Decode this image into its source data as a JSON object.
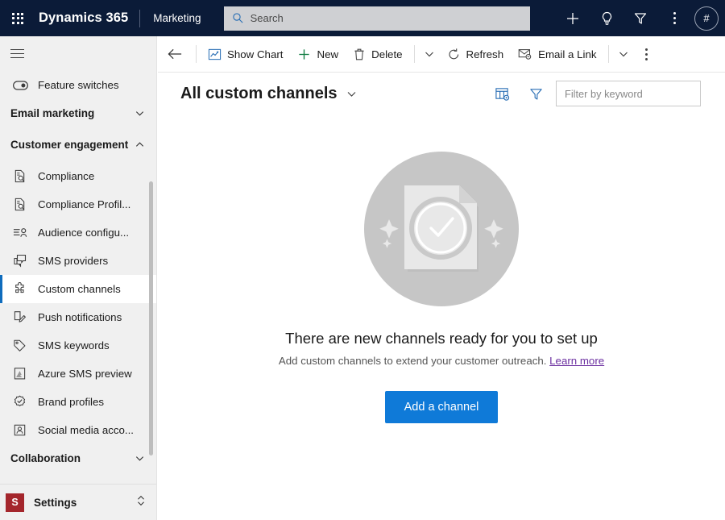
{
  "appbar": {
    "waffle_icon": "waffle-grid-icon",
    "brand": "Dynamics 365",
    "app_name": "Marketing",
    "search": {
      "placeholder": "Search",
      "value": "",
      "icon": "search-icon"
    },
    "actions": [
      {
        "name": "new-record-button",
        "icon": "plus-icon"
      },
      {
        "name": "ideas-button",
        "icon": "lightbulb-icon"
      },
      {
        "name": "filter-button",
        "icon": "funnel-icon"
      },
      {
        "name": "more-options-button",
        "icon": "ellipsis-vertical-icon"
      }
    ],
    "avatar_label": "#"
  },
  "sidebar": {
    "hamburger_icon": "hamburger-menu-icon",
    "items": [
      {
        "label": "Feature switches",
        "icon": "toggle-switch-icon",
        "type": "item",
        "selected": false
      },
      {
        "label": "Email marketing",
        "icon": "chevron-down-icon",
        "type": "group",
        "expanded": false
      },
      {
        "label": "Customer engagement",
        "icon": "chevron-up-icon",
        "type": "group",
        "expanded": true
      },
      {
        "label": "Compliance",
        "icon": "document-search-icon",
        "type": "item",
        "selected": false
      },
      {
        "label": "Compliance Profil...",
        "icon": "document-search-icon",
        "type": "item",
        "selected": false
      },
      {
        "label": "Audience configu...",
        "icon": "audience-icon",
        "type": "item",
        "selected": false
      },
      {
        "label": "SMS providers",
        "icon": "chat-bubbles-icon",
        "type": "item",
        "selected": false
      },
      {
        "label": "Custom channels",
        "icon": "puzzle-piece-icon",
        "type": "item",
        "selected": true
      },
      {
        "label": "Push notifications",
        "icon": "push-notification-icon",
        "type": "item",
        "selected": false
      },
      {
        "label": "SMS keywords",
        "icon": "tag-icon",
        "type": "item",
        "selected": false
      },
      {
        "label": "Azure SMS preview",
        "icon": "azure-sms-icon",
        "type": "item",
        "selected": false
      },
      {
        "label": "Brand profiles",
        "icon": "badge-check-icon",
        "type": "item",
        "selected": false
      },
      {
        "label": "Social media acco...",
        "icon": "social-account-icon",
        "type": "item",
        "selected": false
      },
      {
        "label": "Collaboration",
        "icon": "chevron-down-icon",
        "type": "group",
        "expanded": false
      }
    ],
    "settings": {
      "tile_letter": "S",
      "label": "Settings",
      "icon": "chevron-updown-icon"
    }
  },
  "commandbar": {
    "back_icon": "arrow-left-icon",
    "buttons": [
      {
        "label": "Show Chart",
        "icon": "chart-icon",
        "name": "show-chart-button"
      },
      {
        "label": "New",
        "icon": "plus-green-icon",
        "name": "new-button"
      },
      {
        "label": "Delete",
        "icon": "trash-icon",
        "name": "delete-button"
      }
    ],
    "buttons2": [
      {
        "label": "Refresh",
        "icon": "refresh-icon",
        "name": "refresh-button"
      },
      {
        "label": "Email a Link",
        "icon": "envelope-link-icon",
        "name": "email-a-link-button"
      }
    ],
    "overflow_icon": "ellipsis-vertical-icon",
    "chevron_icon": "chevron-down-icon"
  },
  "view": {
    "title": "All custom channels",
    "title_chevron_icon": "chevron-down-icon",
    "edit_columns_icon": "edit-columns-icon",
    "filter_icon": "funnel-icon",
    "keyword_filter": {
      "placeholder": "Filter by keyword",
      "value": ""
    }
  },
  "empty_state": {
    "illustration_icon": "document-check-sparkle-illustration",
    "title": "There are new channels ready for you to set up",
    "subtitle": "Add custom channels to extend your customer outreach.",
    "link_label": "Learn more",
    "button_label": "Add a channel"
  },
  "colors": {
    "appbar_bg": "#0b1b38",
    "accent_blue": "#0f6cbd",
    "primary_button": "#0f7ad8",
    "link_purple": "#6b2fa0",
    "settings_tile": "#a4262c",
    "sidebar_bg": "#f0f0f0",
    "new_plus_green": "#107c41",
    "illustration_gray": "#c6c6c6"
  }
}
